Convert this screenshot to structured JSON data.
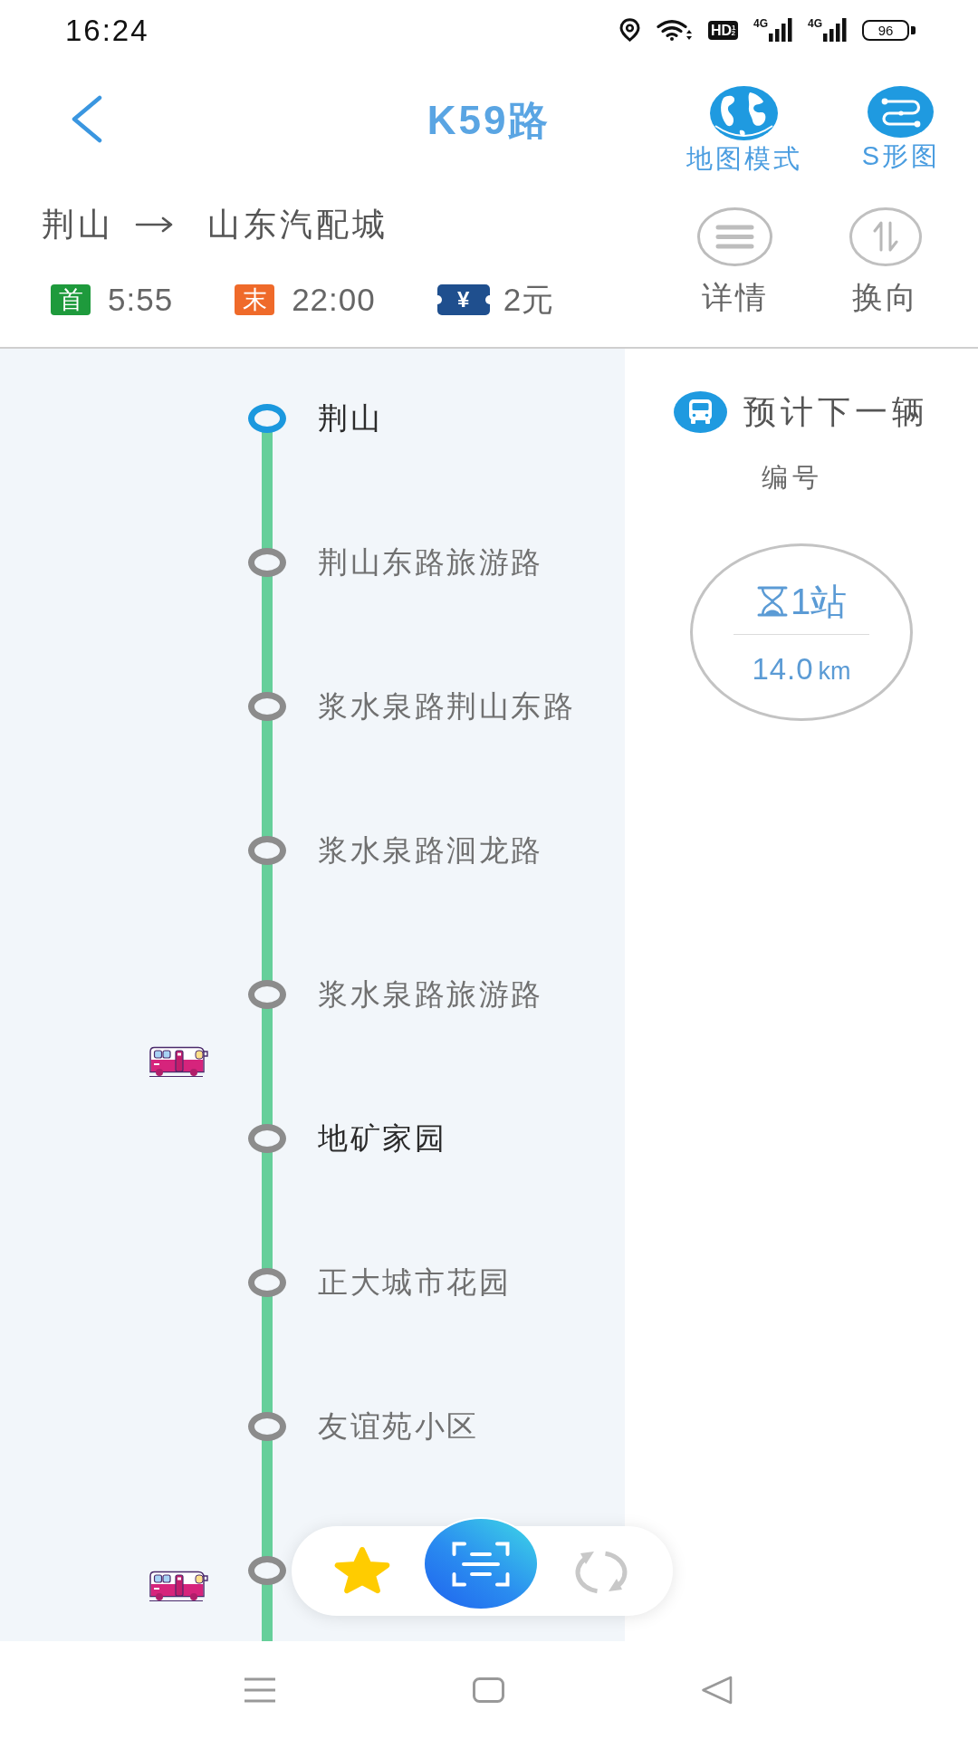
{
  "status_bar": {
    "time": "16:24",
    "hd_label": "HD$^{1}$$_{2}$",
    "signals": [
      {
        "network": "4G"
      },
      {
        "network": "4G"
      }
    ],
    "battery": "96"
  },
  "header": {
    "title": "K59路",
    "actions": [
      {
        "kind": "map",
        "label": "地图模式"
      },
      {
        "kind": "s_diagram",
        "label": "S形图"
      }
    ]
  },
  "route": {
    "from": "荆山",
    "to": "山东汽配城"
  },
  "schedule": [
    {
      "kind": "first",
      "badge": "首",
      "time": "5:55"
    },
    {
      "kind": "last",
      "badge": "末",
      "time": "22:00"
    }
  ],
  "fare": {
    "currency": "¥",
    "price": "2元"
  },
  "tools": [
    {
      "kind": "details",
      "label": "详情"
    },
    {
      "kind": "reverse",
      "label": "换向"
    }
  ],
  "stops": [
    {
      "name": "荆山",
      "selected": true,
      "emphasized": true,
      "bus_en_route": false,
      "bus_at_stop": false
    },
    {
      "name": "荆山东路旅游路",
      "selected": false,
      "emphasized": false,
      "bus_en_route": false,
      "bus_at_stop": false
    },
    {
      "name": "浆水泉路荆山东路",
      "selected": false,
      "emphasized": false,
      "bus_en_route": false,
      "bus_at_stop": false
    },
    {
      "name": "浆水泉路洄龙路",
      "selected": false,
      "emphasized": false,
      "bus_en_route": false,
      "bus_at_stop": false
    },
    {
      "name": "浆水泉路旅游路",
      "selected": false,
      "emphasized": false,
      "bus_en_route": true,
      "bus_at_stop": false
    },
    {
      "name": "地矿家园",
      "selected": false,
      "emphasized": true,
      "bus_en_route": false,
      "bus_at_stop": false
    },
    {
      "name": "正大城市花园",
      "selected": false,
      "emphasized": false,
      "bus_en_route": false,
      "bus_at_stop": false
    },
    {
      "name": "友谊苑小区",
      "selected": false,
      "emphasized": false,
      "bus_en_route": false,
      "bus_at_stop": false
    },
    {
      "selected": false,
      "bus_en_route": false,
      "bus_at_stop": true
    }
  ],
  "next_bus": {
    "title": "预计下一辆",
    "plate_label": "编号",
    "stations": "1站",
    "distance": {
      "value": "14.0",
      "unit": "km"
    }
  },
  "toolbar": {
    "favorited": true
  }
}
